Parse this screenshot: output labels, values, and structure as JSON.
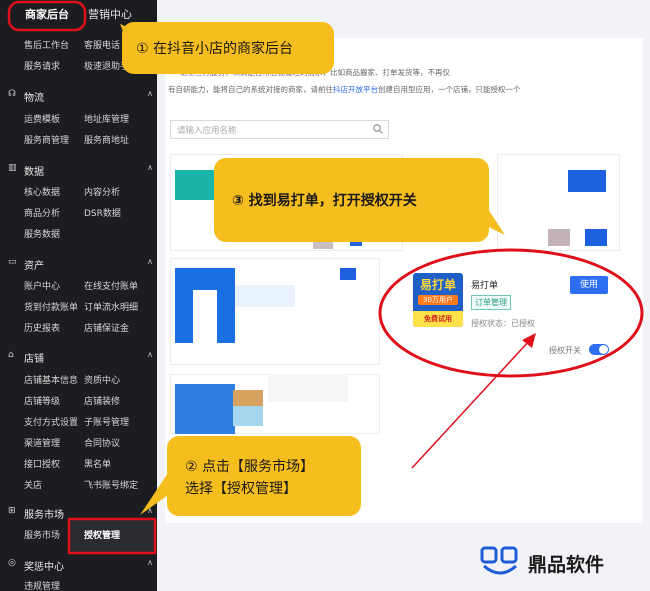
{
  "topnav": {
    "merchant": "商家后台",
    "marketing": "营销中心"
  },
  "sidebar": {
    "rows": [
      [
        "售后工作台",
        "客服电话"
      ],
      [
        "服务请求",
        "极速退助手"
      ],
      [
        "运费模板",
        "地址库管理"
      ],
      [
        "服务商管理",
        "服务商地址"
      ],
      [
        "核心数据",
        "内容分析"
      ],
      [
        "商品分析",
        "DSR数据"
      ],
      [
        "服务数据",
        ""
      ],
      [
        "账户中心",
        "在线支付账单"
      ],
      [
        "货到付款账单",
        "订单流水明细"
      ],
      [
        "历史报表",
        "店铺保证金"
      ],
      [
        "店铺基本信息",
        "资质中心"
      ],
      [
        "店铺等级",
        "店铺装修"
      ],
      [
        "支付方式设置",
        "子账号管理"
      ],
      [
        "渠道管理",
        "合同协议"
      ],
      [
        "接口授权",
        "黑名单"
      ],
      [
        "关店",
        "飞书账号绑定"
      ],
      [
        "服务市场",
        ""
      ],
      [
        "违规管理",
        ""
      ]
    ],
    "sections": [
      "物流",
      "数据",
      "资产",
      "店铺",
      "服务市场",
      "奖惩中心"
    ],
    "active_item": "授权管理"
  },
  "main": {
    "info_line1": "给第三方服务，以满足日常店铺管理的需求，比如商品搬家、打单发货等，不再仅",
    "info_line2_prefix": "有自研能力，能将自己的系统对接的商家，请前往",
    "info_line2_link": "抖店开放平台",
    "info_line2_suffix": "创建自用型应用，一个店铺，只能授权一个",
    "search_placeholder": "请输入应用名称"
  },
  "app_card": {
    "logo_title": "易打单",
    "logo_users": "30万用户",
    "logo_free": "免费试用",
    "name": "易打单",
    "tag": "订单管理",
    "status": "授权状态：已授权",
    "use_button": "使用",
    "toggle_label": "授权开关",
    "toggle_on": true
  },
  "callouts": {
    "step1": "① 在抖音小店的商家后台",
    "step2_line1": "② 点击【服务市场】",
    "step2_line2": "选择【授权管理】",
    "step3": "③ 找到易打单，打开授权开关"
  },
  "watermark": {
    "text": "鼎品软件"
  },
  "colors": {
    "callout": "#f5bd1e",
    "highlight_red": "#e0101a",
    "accent_blue": "#2d6ff0",
    "sidebar_bg": "#1c1d21"
  }
}
